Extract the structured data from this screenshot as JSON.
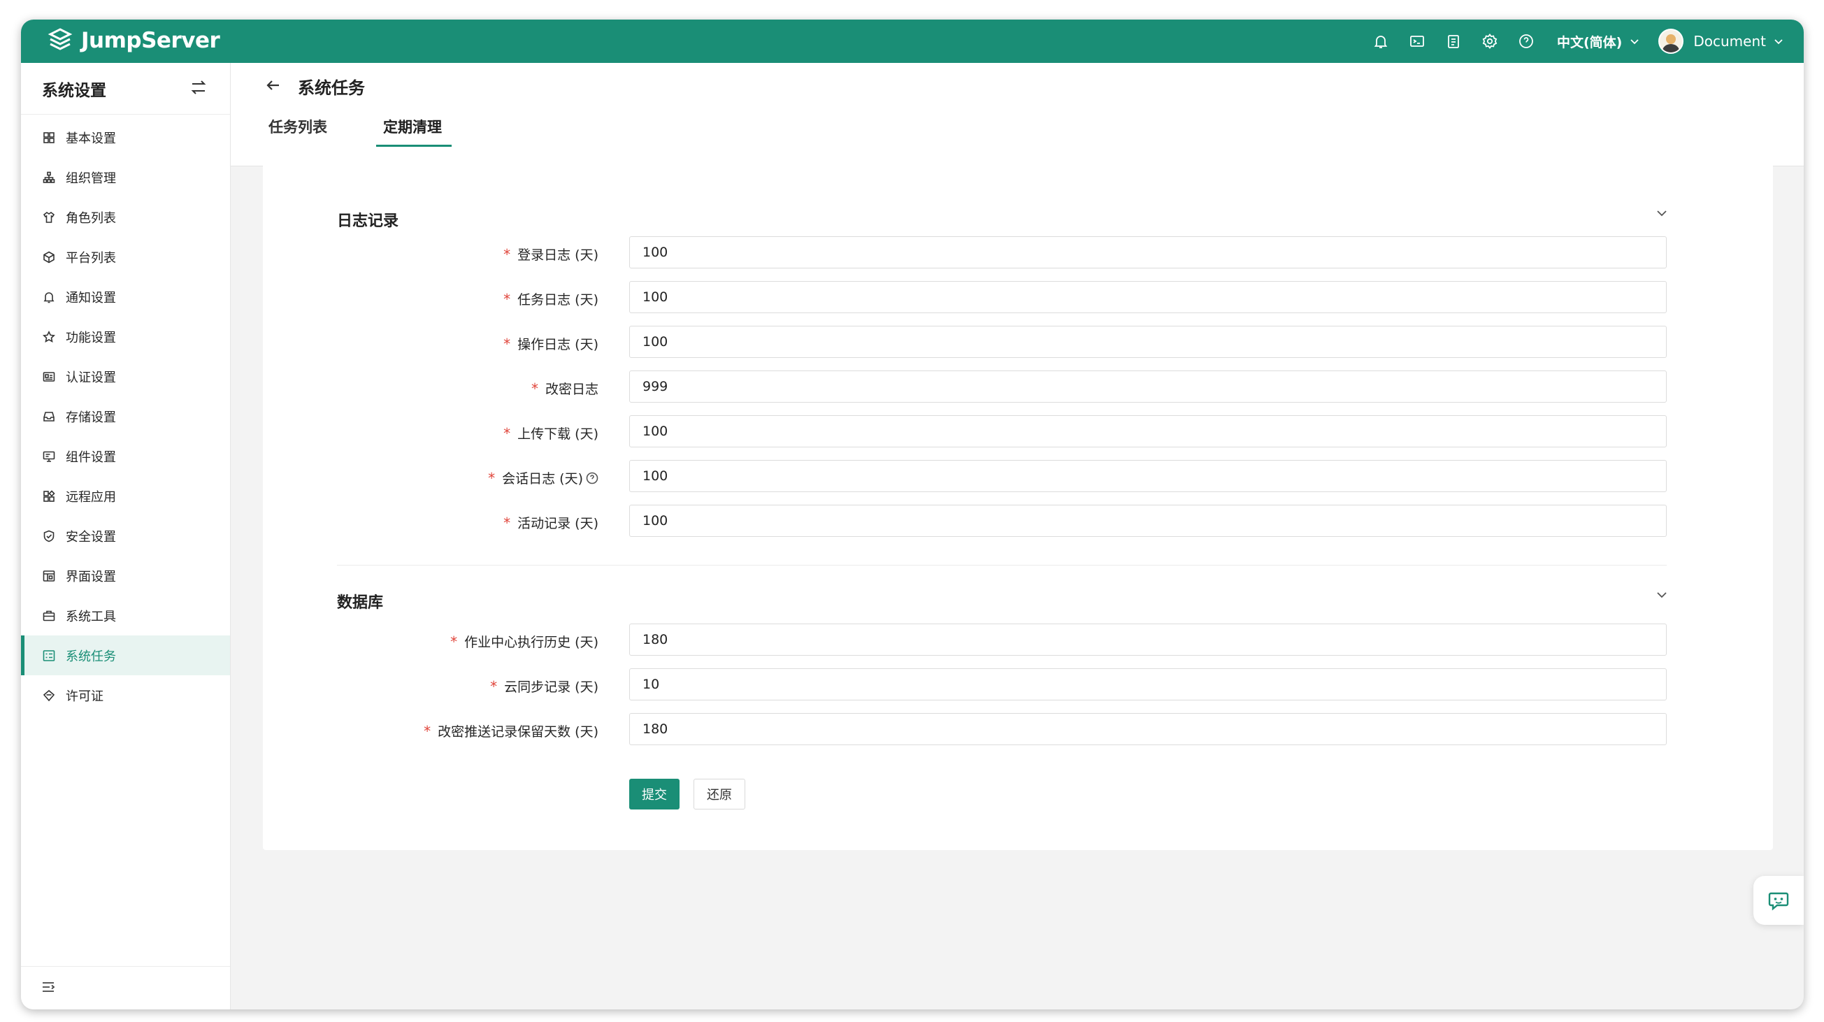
{
  "app": {
    "brand": "JumpServer"
  },
  "topbar": {
    "icons": [
      "bell-icon",
      "terminal-icon",
      "clipboard-icon",
      "gear-icon",
      "help-icon"
    ],
    "language": "中文(简体)",
    "user": "Document"
  },
  "sidebar": {
    "title": "系统设置",
    "items": [
      {
        "label": "基本设置",
        "icon": "grid-icon"
      },
      {
        "label": "组织管理",
        "icon": "org-icon"
      },
      {
        "label": "角色列表",
        "icon": "shirt-icon"
      },
      {
        "label": "平台列表",
        "icon": "cube-icon"
      },
      {
        "label": "通知设置",
        "icon": "bell-icon"
      },
      {
        "label": "功能设置",
        "icon": "star-icon"
      },
      {
        "label": "认证设置",
        "icon": "id-card-icon"
      },
      {
        "label": "存储设置",
        "icon": "inbox-icon"
      },
      {
        "label": "组件设置",
        "icon": "monitor-icon"
      },
      {
        "label": "远程应用",
        "icon": "apps-icon"
      },
      {
        "label": "安全设置",
        "icon": "shield-icon"
      },
      {
        "label": "界面设置",
        "icon": "layout-icon"
      },
      {
        "label": "系统工具",
        "icon": "toolbox-icon"
      },
      {
        "label": "系统任务",
        "icon": "task-icon",
        "active": true
      },
      {
        "label": "许可证",
        "icon": "license-icon"
      }
    ]
  },
  "page": {
    "title": "系统任务",
    "tabs": [
      {
        "label": "任务列表",
        "active": false
      },
      {
        "label": "定期清理",
        "active": true
      }
    ]
  },
  "form": {
    "sections": [
      {
        "title": "日志记录",
        "fields": [
          {
            "label": "登录日志 (天)",
            "value": "100",
            "required": true
          },
          {
            "label": "任务日志 (天)",
            "value": "100",
            "required": true
          },
          {
            "label": "操作日志 (天)",
            "value": "100",
            "required": true
          },
          {
            "label": "改密日志",
            "value": "999",
            "required": true
          },
          {
            "label": "上传下载 (天)",
            "value": "100",
            "required": true
          },
          {
            "label": "会话日志 (天)",
            "value": "100",
            "required": true,
            "help": true
          },
          {
            "label": "活动记录 (天)",
            "value": "100",
            "required": true
          }
        ]
      },
      {
        "title": "数据库",
        "fields": [
          {
            "label": "作业中心执行历史 (天)",
            "value": "180",
            "required": true
          },
          {
            "label": "云同步记录 (天)",
            "value": "10",
            "required": true
          },
          {
            "label": "改密推送记录保留天数 (天)",
            "value": "180",
            "required": true
          }
        ]
      }
    ],
    "submit_label": "提交",
    "reset_label": "还原"
  },
  "colors": {
    "brand": "#1a8e76",
    "required": "#e0453b"
  }
}
